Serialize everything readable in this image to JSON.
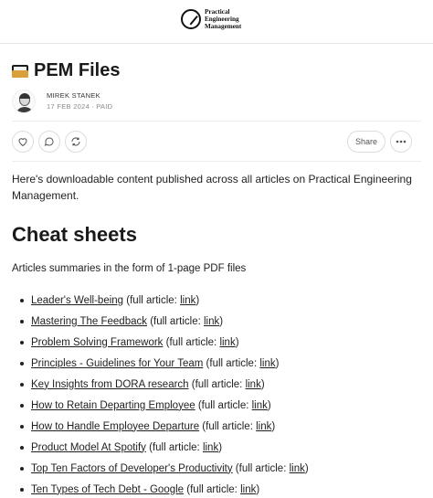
{
  "header": {
    "logo_icon": "pen-nib-icon",
    "logo_lines": [
      "Practical",
      "Engineering",
      "Management"
    ]
  },
  "post": {
    "title_icon": "folder-icon",
    "title": "PEM Files",
    "author": "MIREK STANEK",
    "date_line": "17 FEB 2024 ∙ PAID"
  },
  "actions": {
    "like_icon": "heart-icon",
    "comment_icon": "comment-icon",
    "restack_icon": "restack-icon",
    "share_label": "Share",
    "more_icon": "more-icon"
  },
  "intro": "Here's downloadable content published across all articles on Practical Engineering Management.",
  "section": {
    "heading": "Cheat sheets",
    "subtitle": "Articles summaries in the form of 1-page PDF files",
    "items": [
      {
        "label": "Leader's Well-being",
        "suffix": " (full article: ",
        "link": "link",
        "end": ")"
      },
      {
        "label": "Mastering The Feedback",
        "suffix": " (full article: ",
        "link": "link",
        "end": ")"
      },
      {
        "label": "Problem Solving Framework",
        "suffix": " (full article: ",
        "link": "link",
        "end": ")"
      },
      {
        "label": "Principles - Guidelines for Your Team",
        "suffix": " (full article: ",
        "link": "link",
        "end": ")"
      },
      {
        "label": "Key Insights from DORA research",
        "suffix": " (full article: ",
        "link": "link",
        "end": ")"
      },
      {
        "label": "How to Retain Departing Employee",
        "suffix": " (full article: ",
        "link": "link",
        "end": ")"
      },
      {
        "label": "How to Handle Employee Departure",
        "suffix": " (full article: ",
        "link": "link",
        "end": ")"
      },
      {
        "label": "Product Model At Spotify",
        "suffix": " (full article: ",
        "link": "link",
        "end": ")"
      },
      {
        "label": "Top Ten Factors of Developer's Productivity",
        "suffix": " (full article: ",
        "link": "link",
        "end": ")"
      },
      {
        "label": "Ten Types of Tech Debt - Google",
        "suffix": " (full article: ",
        "link": "link",
        "end": ")"
      }
    ]
  }
}
